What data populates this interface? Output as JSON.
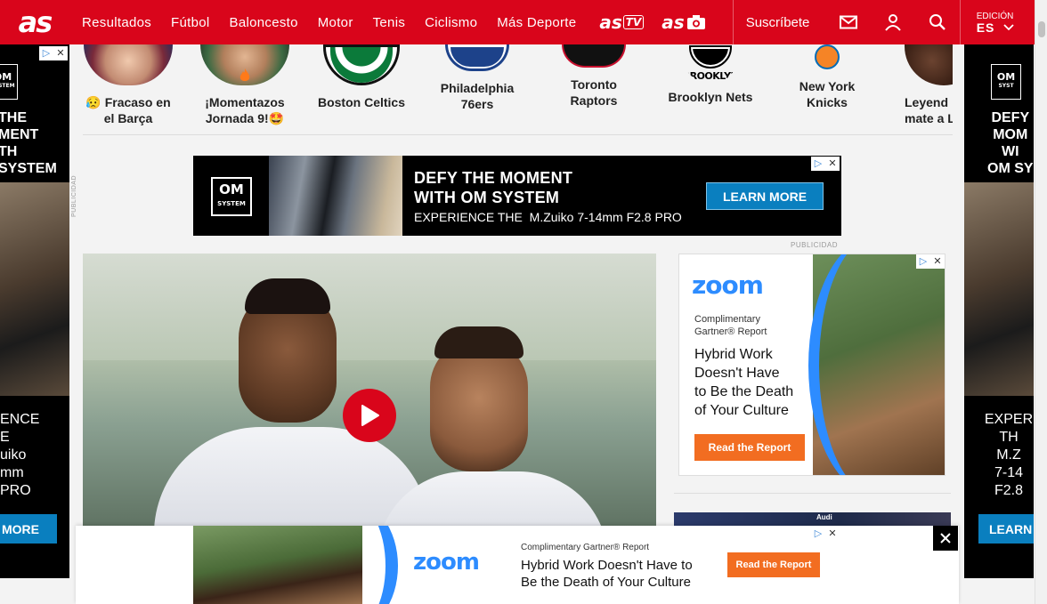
{
  "header": {
    "logo": "as",
    "nav": [
      "Resultados",
      "Fútbol",
      "Baloncesto",
      "Motor",
      "Tenis",
      "Ciclismo",
      "Más Deporte"
    ],
    "brand_tv": "as",
    "brand_tv_tag": "TV",
    "brand_photo": "as",
    "subscribe": "Suscríbete",
    "edition_label": "EDICIÓN",
    "edition_code": "ES"
  },
  "teams": [
    {
      "name_line1": "😥 Fracaso en",
      "name_line2": "el Barça"
    },
    {
      "name_line1": "¡Momentazos",
      "name_line2": "Jornada 9!🤩"
    },
    {
      "name_line1": "Boston Celtics",
      "name_line2": ""
    },
    {
      "name_line1": "Philadelphia",
      "name_line2": "76ers"
    },
    {
      "name_line1": "Toronto",
      "name_line2": "Raptors"
    },
    {
      "name_line1": "Brooklyn Nets",
      "name_line2": ""
    },
    {
      "name_line1": "New York",
      "name_line2": "Knicks"
    },
    {
      "name_line1": "Leyend",
      "name_line2": "mate a L"
    }
  ],
  "ads": {
    "publicidad": "PUBLICIDAD",
    "om": {
      "logo_line1": "OM",
      "logo_line2": "SYSTEM",
      "headline1": "DEFY THE MOMENT",
      "headline2": "WITH OM SYSTEM",
      "body": "EXPERIENCE THE  M.Zuiko 7-14mm F2.8 PRO",
      "cta": "LEARN MORE"
    },
    "left_side": {
      "headline": "THE\nMENT\nTH\nSYSTEM",
      "body": "ENCE\nE\nuiko\nmm\nPRO",
      "cta": "MORE"
    },
    "right_side": {
      "logo_line1": "OM",
      "logo_line2": "SYST",
      "headline": "DEFY\nMOM\nWI\nOM SY",
      "body": "EXPER\nTH\nM.Z\n7-14\nF2.8",
      "cta": "LEARN"
    },
    "zoom": {
      "logo": "zoom",
      "kicker_line1": "Complimentary",
      "kicker_line2": "Gartner® Report",
      "headline": "Hybrid Work\nDoesn't Have\nto Be the Death\nof Your Culture",
      "cta": "Read the Report"
    },
    "sticky": {
      "logo": "zoom",
      "kicker": "Complimentary Gartner® Report",
      "headline_line1": "Hybrid Work Doesn't Have to",
      "headline_line2": "Be the Death of Your Culture",
      "cta": "Read the Report"
    },
    "audi": "Audi"
  },
  "colors": {
    "brand_red": "#d9051b",
    "zoom_blue": "#2d8cff",
    "zoom_orange": "#f26d21",
    "om_button": "#0a7fbf"
  }
}
